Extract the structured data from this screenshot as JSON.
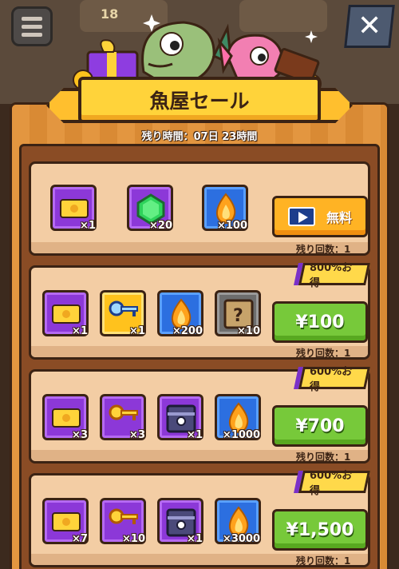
{
  "header": {
    "title": "魚屋セール",
    "timer": "残り時間：07日 23時間"
  },
  "top_tiles": {
    "tile_number": "18"
  },
  "offers": [
    {
      "items": [
        {
          "icon": "ticket-icon",
          "qty": "×1"
        },
        {
          "icon": "gem-icon",
          "qty": "×20"
        },
        {
          "icon": "fire-icon",
          "qty": "×100"
        }
      ],
      "badge": "",
      "price": "無料",
      "remaining": "残り回数：1"
    },
    {
      "items": [
        {
          "icon": "ticket-icon",
          "qty": "×1"
        },
        {
          "icon": "key-icon",
          "qty": "×1"
        },
        {
          "icon": "fire-icon",
          "qty": "×200"
        },
        {
          "icon": "mystery-box-icon",
          "qty": "×10"
        }
      ],
      "badge": "800%お得",
      "price": "¥100",
      "remaining": "残り回数：1"
    },
    {
      "items": [
        {
          "icon": "ticket-icon",
          "qty": "×3"
        },
        {
          "icon": "key-icon",
          "qty": "×3"
        },
        {
          "icon": "chest-icon",
          "qty": "×1"
        },
        {
          "icon": "fire-icon",
          "qty": "×1000"
        }
      ],
      "badge": "600%お得",
      "price": "¥700",
      "remaining": "残り回数：1"
    },
    {
      "items": [
        {
          "icon": "ticket-icon",
          "qty": "×7"
        },
        {
          "icon": "key-icon",
          "qty": "×10"
        },
        {
          "icon": "chest-icon",
          "qty": "×1"
        },
        {
          "icon": "fire-icon",
          "qty": "×3000"
        }
      ],
      "badge": "600%お得",
      "price": "¥1,500",
      "remaining": "残り回数：1"
    }
  ],
  "colors": {
    "accent": "#ffd33a",
    "buy_green": "#77c93a",
    "buy_orange": "#ffb324",
    "item_purple": "#8c38d8",
    "item_blue": "#2c6fe0"
  }
}
